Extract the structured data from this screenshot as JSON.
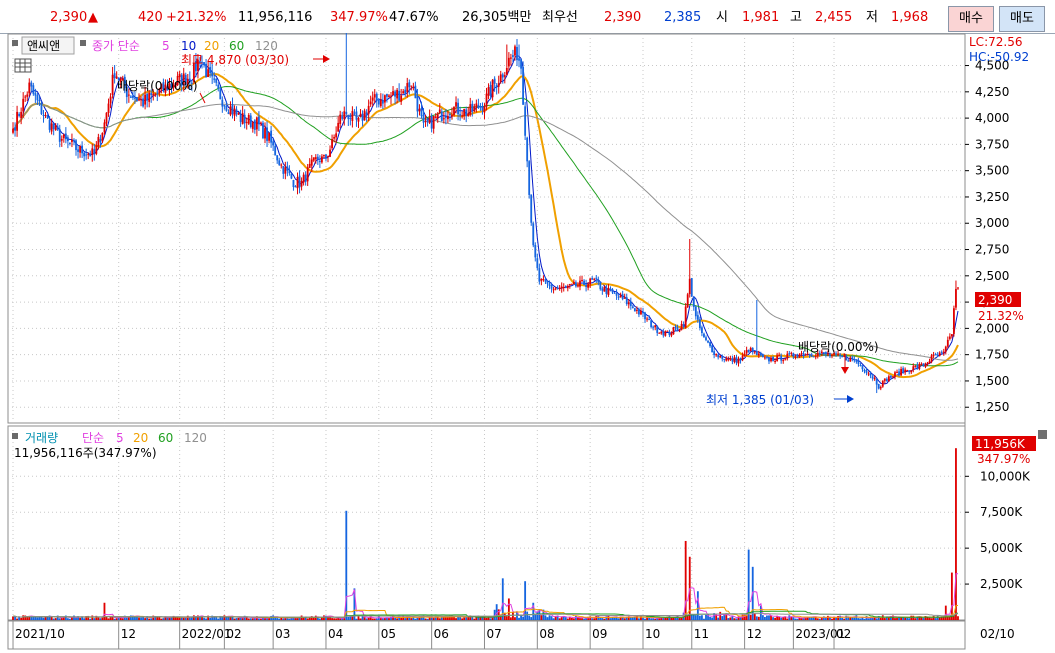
{
  "topbar": {
    "price": "2,390",
    "change_arrow": "▲",
    "change": "420",
    "change_pct": "+21.32%",
    "volume": "11,956,116",
    "volume_ratio": "347.97%",
    "turnover_pct": "47.67%",
    "amount": "26,305백만",
    "priority_label": "최우선",
    "best_ask": "2,390",
    "best_bid": "2,385",
    "open_label": "시",
    "open": "1,981",
    "high_label": "고",
    "high": "2,455",
    "low_label": "저",
    "low": "1,968",
    "buy_label": "매수",
    "sell_label": "매도"
  },
  "colors": {
    "up": "#e00000",
    "down": "#1565e0",
    "ma5": "#0018c8",
    "ma20": "#f0a000",
    "ma60": "#20a020",
    "ma120": "#909090",
    "vol_ma5": "#e040e0"
  },
  "price_panel": {
    "toolbar_button": "앤씨앤",
    "legend_prefix": "종가 단순",
    "ma_labels": [
      "5",
      "10",
      "20",
      "60",
      "120"
    ],
    "lc": "LC:72.56",
    "hc": "HC:-50.92",
    "high_note": "최고 4,870 (03/30)",
    "low_note": "최저 1,385 (01/03)",
    "dividend_note_1": "배당락(0.00%)",
    "dividend_note_2": "배당락(0.00%)",
    "last_price_tag": "2,390",
    "last_pct_tag": "21.32%"
  },
  "volume_panel": {
    "legend_title": "거래량",
    "legend_prefix": "단순",
    "ma_labels": [
      "5",
      "20",
      "60",
      "120"
    ],
    "volume_note": "11,956,116주(347.97%)",
    "last_volume_tag": "11,956K",
    "last_ratio_tag": "347.97%"
  },
  "chart_data": {
    "type": "candlestick",
    "x_axis": {
      "labels": [
        "2021/10",
        "12",
        "2022/01",
        "02",
        "03",
        "04",
        "05",
        "06",
        "07",
        "08",
        "09",
        "10",
        "11",
        "12",
        "2023/01",
        "02",
        "02/10"
      ]
    },
    "price_axis": {
      "ylim": [
        1100,
        4800
      ],
      "ticks": [
        1250,
        1500,
        1750,
        2000,
        2250,
        2500,
        2750,
        3000,
        3250,
        3500,
        3750,
        4000,
        4250,
        4500
      ],
      "tick_labels": [
        "1,250",
        "1,500",
        "1,750",
        "2,000",
        "2,250",
        "2,500",
        "2,750",
        "3,000",
        "3,250",
        "3,500",
        "3,750",
        "4,000",
        "4,250",
        "4,500"
      ]
    },
    "volume_axis": {
      "ylim": [
        0,
        13500
      ],
      "ticks": [
        2500,
        5000,
        7500,
        10000
      ],
      "tick_labels": [
        "2,500K",
        "5,000K",
        "7,500K",
        "10,000K"
      ]
    },
    "close_path": [
      [
        0,
        3900
      ],
      [
        8,
        4300
      ],
      [
        16,
        4000
      ],
      [
        24,
        3800
      ],
      [
        32,
        3700
      ],
      [
        40,
        3650
      ],
      [
        45,
        3950
      ],
      [
        50,
        4450
      ],
      [
        56,
        4250
      ],
      [
        64,
        4150
      ],
      [
        72,
        4250
      ],
      [
        80,
        4350
      ],
      [
        88,
        4400
      ],
      [
        92,
        4580
      ],
      [
        96,
        4400
      ],
      [
        104,
        4150
      ],
      [
        112,
        4000
      ],
      [
        120,
        3950
      ],
      [
        126,
        3800
      ],
      [
        132,
        3550
      ],
      [
        138,
        3400
      ],
      [
        142,
        3380
      ],
      [
        146,
        3520
      ],
      [
        150,
        3620
      ],
      [
        153,
        3600
      ],
      [
        157,
        3750
      ],
      [
        161,
        4000
      ],
      [
        164,
        4050
      ],
      [
        170,
        3950
      ],
      [
        176,
        4150
      ],
      [
        184,
        4200
      ],
      [
        192,
        4250
      ],
      [
        196,
        4350
      ],
      [
        202,
        3900
      ],
      [
        208,
        4000
      ],
      [
        216,
        4100
      ],
      [
        224,
        4050
      ],
      [
        232,
        4150
      ],
      [
        236,
        4300
      ],
      [
        240,
        4400
      ],
      [
        244,
        4550
      ],
      [
        248,
        4620
      ],
      [
        250,
        4500
      ],
      [
        253,
        3600
      ],
      [
        256,
        2750
      ],
      [
        259,
        2450
      ],
      [
        262,
        2420
      ],
      [
        266,
        2380
      ],
      [
        272,
        2380
      ],
      [
        280,
        2420
      ],
      [
        286,
        2450
      ],
      [
        290,
        2380
      ],
      [
        296,
        2320
      ],
      [
        302,
        2250
      ],
      [
        310,
        2120
      ],
      [
        316,
        2000
      ],
      [
        322,
        1950
      ],
      [
        327,
        2000
      ],
      [
        330,
        2050
      ],
      [
        333,
        2450
      ],
      [
        336,
        2100
      ],
      [
        340,
        1900
      ],
      [
        346,
        1750
      ],
      [
        352,
        1700
      ],
      [
        358,
        1700
      ],
      [
        362,
        1800
      ],
      [
        366,
        1750
      ],
      [
        370,
        1700
      ],
      [
        378,
        1720
      ],
      [
        388,
        1760
      ],
      [
        398,
        1760
      ],
      [
        406,
        1730
      ],
      [
        414,
        1700
      ],
      [
        420,
        1600
      ],
      [
        424,
        1520
      ],
      [
        426,
        1450
      ],
      [
        430,
        1520
      ],
      [
        436,
        1580
      ],
      [
        442,
        1620
      ],
      [
        448,
        1650
      ],
      [
        452,
        1720
      ],
      [
        458,
        1760
      ],
      [
        462,
        1960
      ],
      [
        464,
        2390
      ]
    ],
    "spikes": [
      [
        164,
        4870
      ],
      [
        243,
        4700
      ],
      [
        249,
        4700
      ],
      [
        333,
        2850
      ],
      [
        366,
        2270
      ],
      [
        425,
        1385
      ],
      [
        464,
        2455
      ]
    ],
    "volume_spikes": [
      [
        45,
        1200
      ],
      [
        164,
        7600
      ],
      [
        168,
        2200
      ],
      [
        238,
        1100
      ],
      [
        241,
        2900
      ],
      [
        244,
        1500
      ],
      [
        252,
        2700
      ],
      [
        256,
        1200
      ],
      [
        331,
        5500
      ],
      [
        333,
        4400
      ],
      [
        337,
        2000
      ],
      [
        362,
        4900
      ],
      [
        364,
        3700
      ],
      [
        368,
        1000
      ],
      [
        459,
        1000
      ],
      [
        462,
        3300
      ],
      [
        464,
        11956
      ]
    ]
  }
}
